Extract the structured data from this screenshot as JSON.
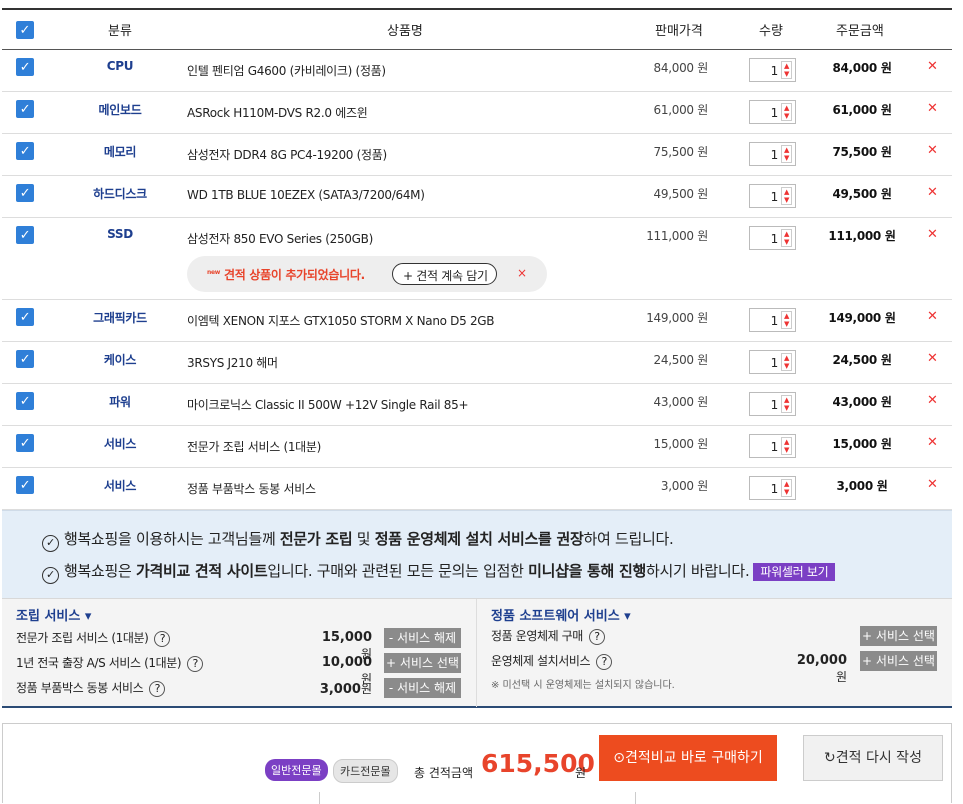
{
  "header": {
    "category": "분류",
    "name": "상품명",
    "price": "판매가격",
    "qty": "수량",
    "total": "주문금액"
  },
  "rows": [
    {
      "category": "CPU",
      "name": "인텔 펜티엄 G4600 (카비레이크) (정품)",
      "price": "84,000 원",
      "qty": "1",
      "total": "84,000 원"
    },
    {
      "category": "메인보드",
      "name": "ASRock H110M-DVS R2.0 에즈윈",
      "price": "61,000 원",
      "qty": "1",
      "total": "61,000 원"
    },
    {
      "category": "메모리",
      "name": "삼성전자 DDR4 8G PC4-19200 (정품)",
      "price": "75,500 원",
      "qty": "1",
      "total": "75,500 원"
    },
    {
      "category": "하드디스크",
      "name": "WD 1TB BLUE 10EZEX (SATA3/7200/64M)",
      "price": "49,500 원",
      "qty": "1",
      "total": "49,500 원"
    },
    {
      "category": "SSD",
      "name": "삼성전자 850 EVO Series (250GB)",
      "price": "111,000 원",
      "qty": "1",
      "total": "111,000 원"
    },
    {
      "category": "그래픽카드",
      "name": "이엠텍 XENON 지포스 GTX1050 STORM X Nano D5 2GB",
      "price": "149,000 원",
      "qty": "1",
      "total": "149,000 원"
    },
    {
      "category": "케이스",
      "name": "3RSYS J210 해머",
      "price": "24,500 원",
      "qty": "1",
      "total": "24,500 원"
    },
    {
      "category": "파워",
      "name": "마이크로닉스 Classic II 500W +12V Single Rail 85+",
      "price": "43,000 원",
      "qty": "1",
      "total": "43,000 원"
    },
    {
      "category": "서비스",
      "name": "전문가 조립 서비스 (1대분)",
      "price": "15,000 원",
      "qty": "1",
      "total": "15,000 원"
    },
    {
      "category": "서비스",
      "name": "정품 부품박스 동봉 서비스",
      "price": "3,000 원",
      "qty": "1",
      "total": "3,000 원"
    }
  ],
  "notice": {
    "badge": "new",
    "text": "견적 상품이 추가되었습니다.",
    "button": "+ 견적 계속 담기",
    "close": "×"
  },
  "info": {
    "line1_a": "행복쇼핑을 이용하시는 고객님들께 ",
    "line1_b": "전문가 조립",
    "line1_c": " 및 ",
    "line1_d": "정품 운영체제 설치 서비스를 권장",
    "line1_e": "하여 드립니다.",
    "line2_a": "행복쇼핑은 ",
    "line2_b": "가격비교 견적 사이트",
    "line2_c": "입니다. 구매와 관련된 모든 문의는 입점한 ",
    "line2_d": "미니샵을 통해 진행",
    "line2_e": "하시기 바랍니다.",
    "power_btn": "파워셀러 보기"
  },
  "assembly": {
    "title": "조립 서비스 ▾",
    "items": [
      {
        "label": "전문가 조립 서비스 (1대분)",
        "price": "15,000",
        "unit": "원",
        "button": "- 서비스 해제"
      },
      {
        "label": "1년 전국 출장 A/S 서비스 (1대분)",
        "price": "10,000",
        "unit": "원",
        "button": "+ 서비스 선택"
      },
      {
        "label": "정품 부품박스 동봉 서비스",
        "price": "3,000",
        "unit": "원",
        "button": "- 서비스 해제"
      }
    ]
  },
  "software": {
    "title": "정품 소프트웨어 서비스 ▾",
    "items": [
      {
        "label": "정품 운영체제 구매",
        "price": "",
        "unit": "",
        "button": "+ 서비스 선택"
      },
      {
        "label": "운영체제 설치서비스",
        "price": "20,000",
        "unit": "원",
        "button": "+ 서비스 선택"
      }
    ],
    "note": "※ 미선택 시 운영체제는 설치되지 않습니다."
  },
  "footer": {
    "tag1": "일반전문몰",
    "tag2": "카드전문몰",
    "total_label": "총 견적금액",
    "total_value": "615,500",
    "total_unit": "원",
    "buy_btn": "견적비교 바로 구매하기",
    "reset_btn": "견적 다시 작성"
  },
  "colors": {
    "accent": "#2f7fd8",
    "brand_red": "#ed4c1f",
    "purple": "#7b3fc4",
    "navy": "#1e3f8f"
  }
}
